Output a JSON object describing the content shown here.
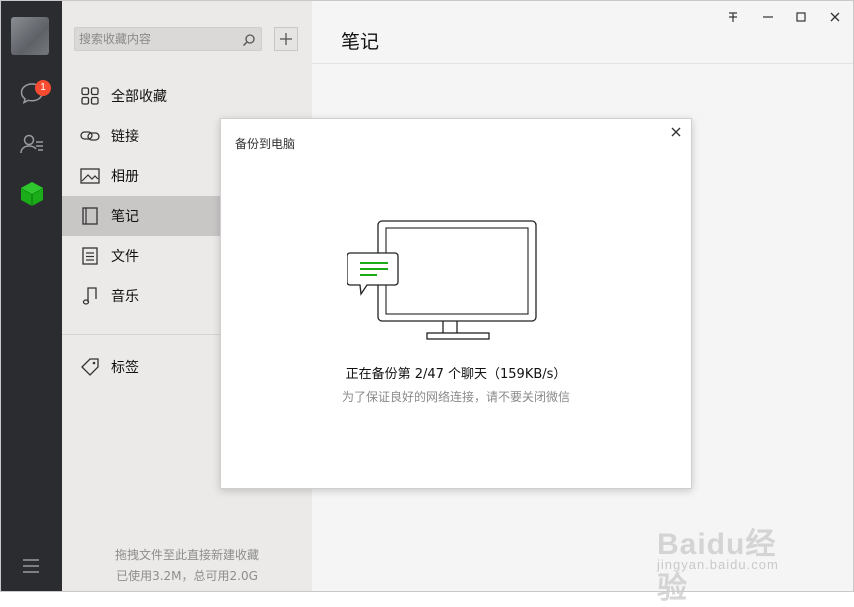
{
  "rail": {
    "chat_badge": "1",
    "icons": [
      "avatar",
      "chat-icon",
      "contacts-icon",
      "favorites-cube-icon",
      "menu-icon"
    ],
    "accent_color": "#1aad19",
    "badge_color": "#f74c31"
  },
  "sidebar": {
    "search_placeholder": "搜索收藏内容",
    "items": [
      {
        "label": "全部收藏",
        "icon": "grid-icon"
      },
      {
        "label": "链接",
        "icon": "link-icon"
      },
      {
        "label": "相册",
        "icon": "image-icon"
      },
      {
        "label": "笔记",
        "icon": "note-icon"
      },
      {
        "label": "文件",
        "icon": "file-icon"
      },
      {
        "label": "音乐",
        "icon": "music-icon"
      },
      {
        "label": "标签",
        "icon": "tag-icon"
      }
    ],
    "active_item": "笔记",
    "footer_hint": "拖拽文件至此直接新建收藏",
    "footer_usage": "已使用3.2M，总可用2.0G"
  },
  "main": {
    "title": "笔记"
  },
  "dialog": {
    "title": "备份到电脑",
    "status": "正在备份第 2/47 个聊天（159KB/s）",
    "hint": "为了保证良好的网络连接，请不要关闭微信"
  },
  "watermark": {
    "text": "Baidu经验",
    "sub": "jingyan.baidu.com"
  }
}
